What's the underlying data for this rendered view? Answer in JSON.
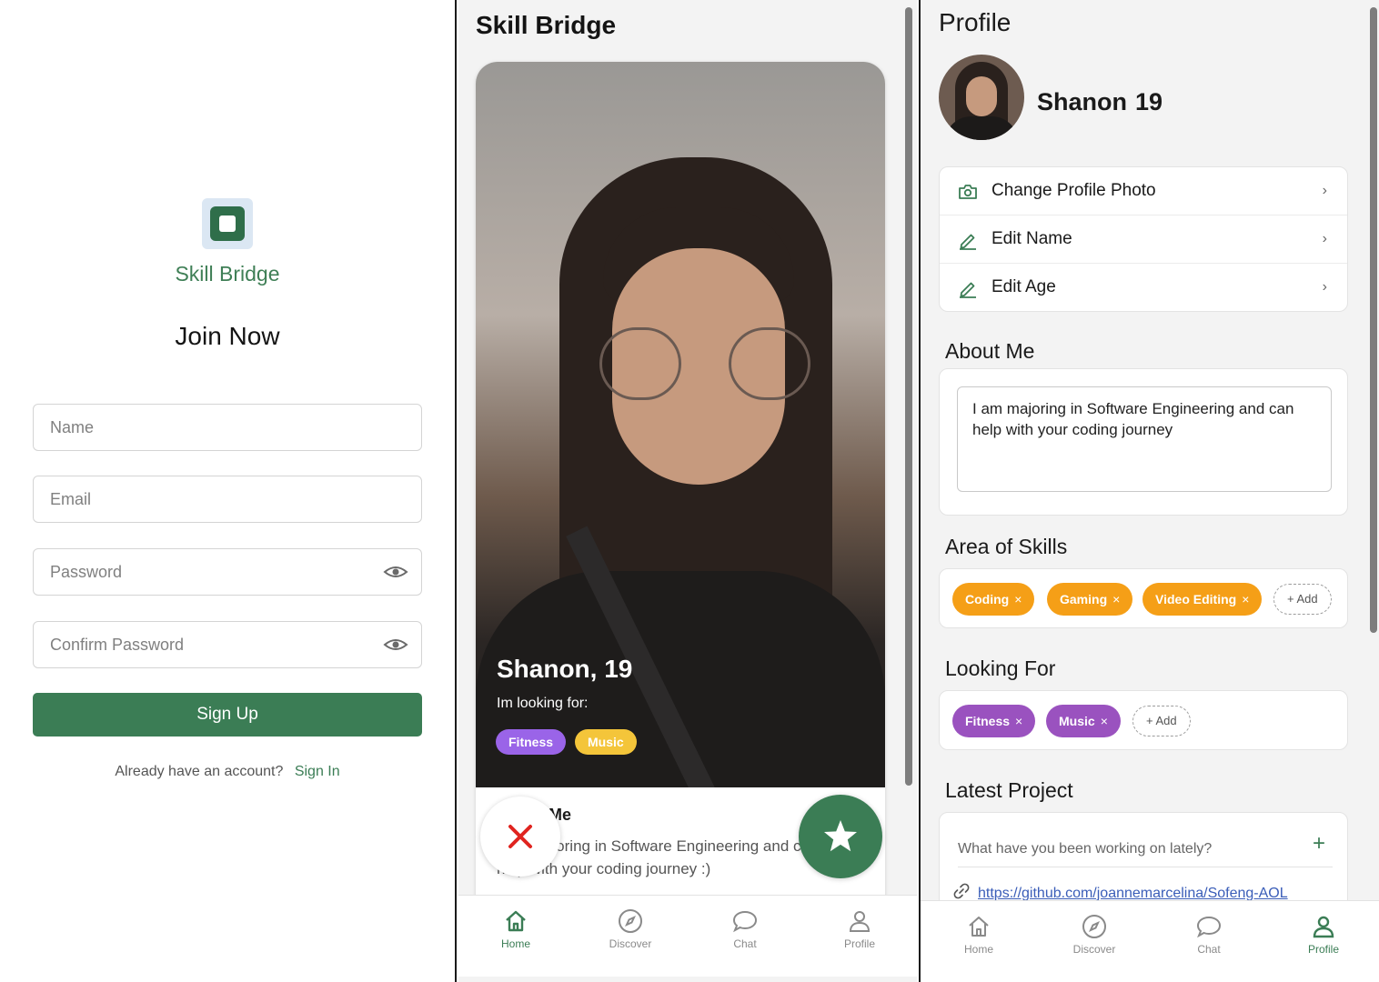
{
  "signup": {
    "brand": "Skill Bridge",
    "title": "Join Now",
    "name_placeholder": "Name",
    "email_placeholder": "Email",
    "password_placeholder": "Password",
    "confirm_placeholder": "Confirm Password",
    "signup_label": "Sign Up",
    "have_account": "Already have an account?",
    "signin_label": "Sign In"
  },
  "home": {
    "title": "Skill Bridge",
    "person_name": "Shanon, 19",
    "looking_label": "Im looking for:",
    "tags": [
      "Fitness",
      "Music"
    ],
    "about_title": "About Me",
    "about_text": "I am majoring in Software Engineering and can help with your coding journey :)"
  },
  "nav": {
    "home": "Home",
    "discover": "Discover",
    "chat": "Chat",
    "profile": "Profile"
  },
  "profile": {
    "title": "Profile",
    "name": "Shanon",
    "age": "19",
    "menu": [
      "Change Profile Photo",
      "Edit Name",
      "Edit Age"
    ],
    "about_title": "About Me",
    "about_text": "I am majoring in Software Engineering and can help with your coding journey",
    "skills_title": "Area of Skills",
    "skills": [
      "Coding",
      "Gaming",
      "Video Editing"
    ],
    "looking_title": "Looking For",
    "looking": [
      "Fitness",
      "Music"
    ],
    "add_label": "+ Add",
    "remove_glyph": "×",
    "project_title": "Latest Project",
    "project_placeholder": "What have you been working on lately?",
    "project_link": "https://github.com/joannemarcelina/Sofeng-AOL"
  },
  "colors": {
    "primary_green": "#3b7d55",
    "skill_orange": "#f59f17",
    "looking_purple": "#9a52bf",
    "fitness_tag": "#9a64e8",
    "music_tag": "#f4c53a",
    "reject_red": "#e0241f"
  }
}
